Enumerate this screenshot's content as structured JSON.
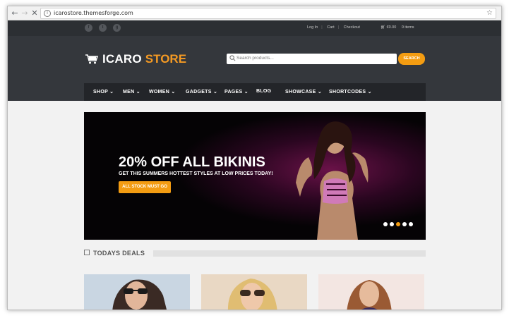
{
  "browser": {
    "url": "icarostore.themesforge.com"
  },
  "topbar": {
    "social_icons": [
      "facebook-icon",
      "twitter-icon",
      "google-plus-icon"
    ],
    "links": [
      "Log In",
      "Cart",
      "Checkout"
    ],
    "cart_total": "€0.00",
    "cart_items": "0 items"
  },
  "header": {
    "brand": "ICARO",
    "brand_accent": "STORE",
    "search_placeholder": "Search products...",
    "search_button": "SEARCH",
    "accent_color": "#f39c12"
  },
  "nav": {
    "items": [
      "SHOP",
      "MEN",
      "WOMEN",
      "GADGETS",
      "PAGES",
      "BLOG",
      "SHOWCASE",
      "SHORTCODES"
    ]
  },
  "banner": {
    "headline": "20% OFF ALL BIKINIS",
    "subline": "GET THIS SUMMERS HOTTEST STYLES AT LOW PRICES TODAY!",
    "cta": "ALL STOCK MUST GO",
    "slides": 5,
    "active_slide": 4
  },
  "deals": {
    "title": "TODAYS DEALS"
  }
}
